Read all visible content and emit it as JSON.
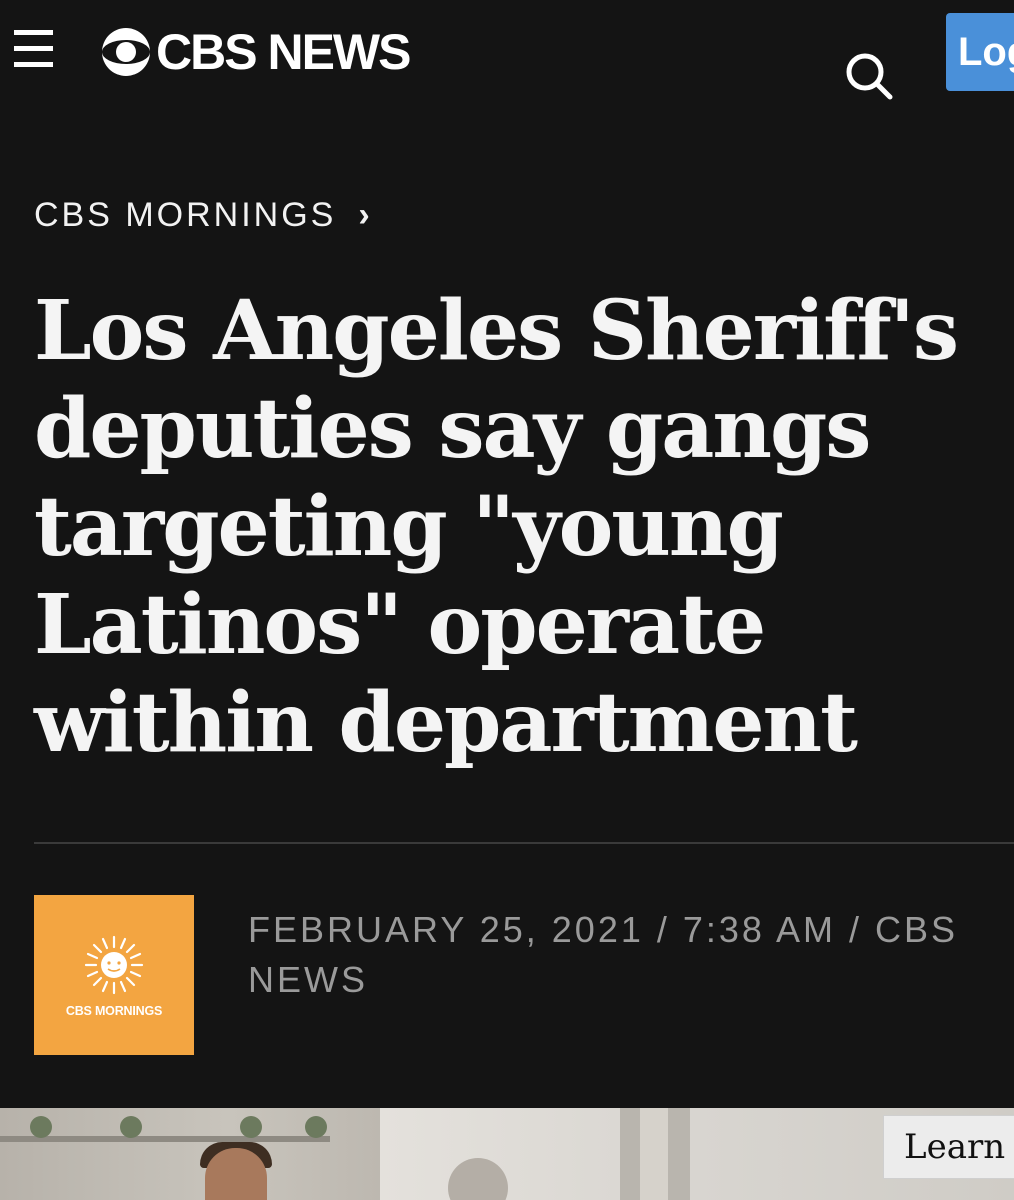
{
  "header": {
    "logo_text": "CBS NEWS",
    "login_label": "Log"
  },
  "breadcrumb": {
    "label": "CBS MORNINGS",
    "chevron": "›"
  },
  "article": {
    "headline": "Los Angeles Sheriff's deputies say gangs targeting \"young Latinos\" operate within department",
    "byline_line1": "FEBRUARY 25, 2021 / 7:38 AM / CBS",
    "byline_line2": "NEWS"
  },
  "show_logo": {
    "text": "CBS MORNINGS",
    "background": "#f3a541"
  },
  "video": {
    "learn_more_label": "Learn M"
  },
  "colors": {
    "page_background": "#141414",
    "login_button": "#4a90d9",
    "byline_text": "#9a9a9a"
  },
  "icons": {
    "menu": "hamburger-menu-icon",
    "logo_eye": "cbs-eye-icon",
    "search": "search-icon",
    "show_logo_sun": "sun-icon"
  }
}
